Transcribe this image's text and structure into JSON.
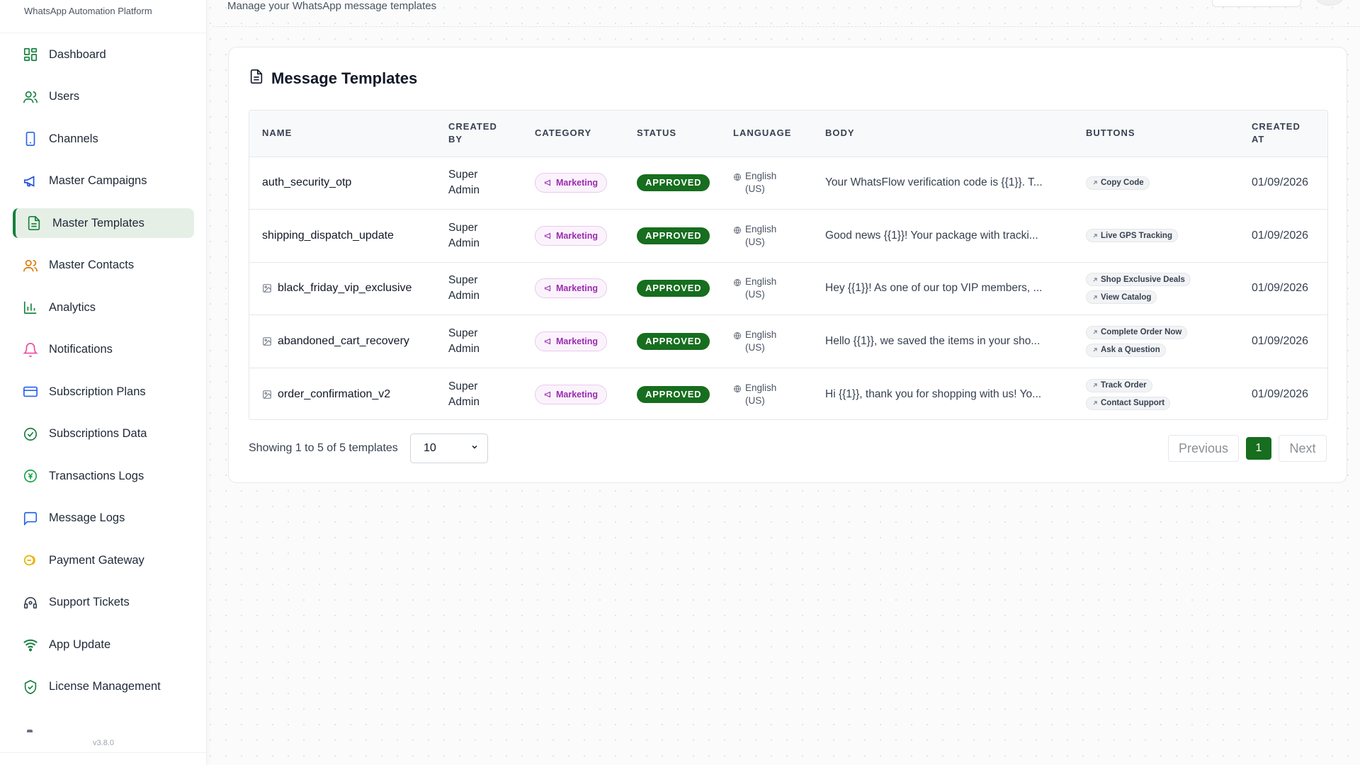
{
  "brand": {
    "subtitle": "WhatsApp Automation Platform"
  },
  "header": {
    "subtitle": "Manage your WhatsApp message templates"
  },
  "sidebar": {
    "items": [
      {
        "label": "Dashboard",
        "icon": "dashboard-icon"
      },
      {
        "label": "Users",
        "icon": "users-icon"
      },
      {
        "label": "Channels",
        "icon": "phone-icon"
      },
      {
        "label": "Master Campaigns",
        "icon": "megaphone-icon"
      },
      {
        "label": "Master Templates",
        "icon": "document-icon",
        "active": true
      },
      {
        "label": "Master Contacts",
        "icon": "contacts-icon"
      },
      {
        "label": "Analytics",
        "icon": "bar-chart-icon"
      },
      {
        "label": "Notifications",
        "icon": "bell-icon"
      },
      {
        "label": "Subscription Plans",
        "icon": "credit-card-icon"
      },
      {
        "label": "Subscriptions Data",
        "icon": "check-circle-icon"
      },
      {
        "label": "Transactions Logs",
        "icon": "currency-circle-icon"
      },
      {
        "label": "Message Logs",
        "icon": "message-icon"
      },
      {
        "label": "Payment Gateway",
        "icon": "coins-icon"
      },
      {
        "label": "Support Tickets",
        "icon": "headset-icon"
      },
      {
        "label": "App Update",
        "icon": "wifi-icon"
      },
      {
        "label": "License Management",
        "icon": "shield-check-icon"
      }
    ],
    "version": "v3.8.0"
  },
  "card": {
    "title": "Message Templates"
  },
  "table": {
    "headers": {
      "name": "NAME",
      "created_by": "CREATED BY",
      "category": "CATEGORY",
      "status": "STATUS",
      "language": "LANGUAGE",
      "body": "BODY",
      "buttons": "BUTTONS",
      "created_at": "CREATED AT"
    },
    "rows": [
      {
        "name": "auth_security_otp",
        "has_image": false,
        "created_by": "Super Admin",
        "category": "Marketing",
        "status": "APPROVED",
        "language": "English (US)",
        "body": "Your WhatsFlow verification code is {{1}}. T...",
        "buttons": [
          "Copy Code"
        ],
        "created_at": "01/09/2026"
      },
      {
        "name": "shipping_dispatch_update",
        "has_image": false,
        "created_by": "Super Admin",
        "category": "Marketing",
        "status": "APPROVED",
        "language": "English (US)",
        "body": "Good news {{1}}! Your package with tracki...",
        "buttons": [
          "Live GPS Tracking"
        ],
        "created_at": "01/09/2026"
      },
      {
        "name": "black_friday_vip_exclusive",
        "has_image": true,
        "created_by": "Super Admin",
        "category": "Marketing",
        "status": "APPROVED",
        "language": "English (US)",
        "body": "Hey {{1}}! As one of our top VIP members, ...",
        "buttons": [
          "Shop Exclusive Deals",
          "View Catalog"
        ],
        "created_at": "01/09/2026"
      },
      {
        "name": "abandoned_cart_recovery",
        "has_image": true,
        "created_by": "Super Admin",
        "category": "Marketing",
        "status": "APPROVED",
        "language": "English (US)",
        "body": "Hello {{1}}, we saved the items in your sho...",
        "buttons": [
          "Complete Order Now",
          "Ask a Question"
        ],
        "created_at": "01/09/2026"
      },
      {
        "name": "order_confirmation_v2",
        "has_image": true,
        "created_by": "Super Admin",
        "category": "Marketing",
        "status": "APPROVED",
        "language": "English (US)",
        "body": "Hi {{1}}, thank you for shopping with us! Yo...",
        "buttons": [
          "Track Order",
          "Contact Support"
        ],
        "created_at": "01/09/2026"
      }
    ]
  },
  "footer": {
    "showing": "Showing 1 to 5 of 5 templates",
    "page_size": "10",
    "prev_label": "Previous",
    "current_page": "1",
    "next_label": "Next"
  },
  "colors": {
    "accent": "#166e1e",
    "active_bg": "#e6efe6",
    "category_text": "#9b2bb0",
    "category_bg": "#fbf3fc"
  }
}
